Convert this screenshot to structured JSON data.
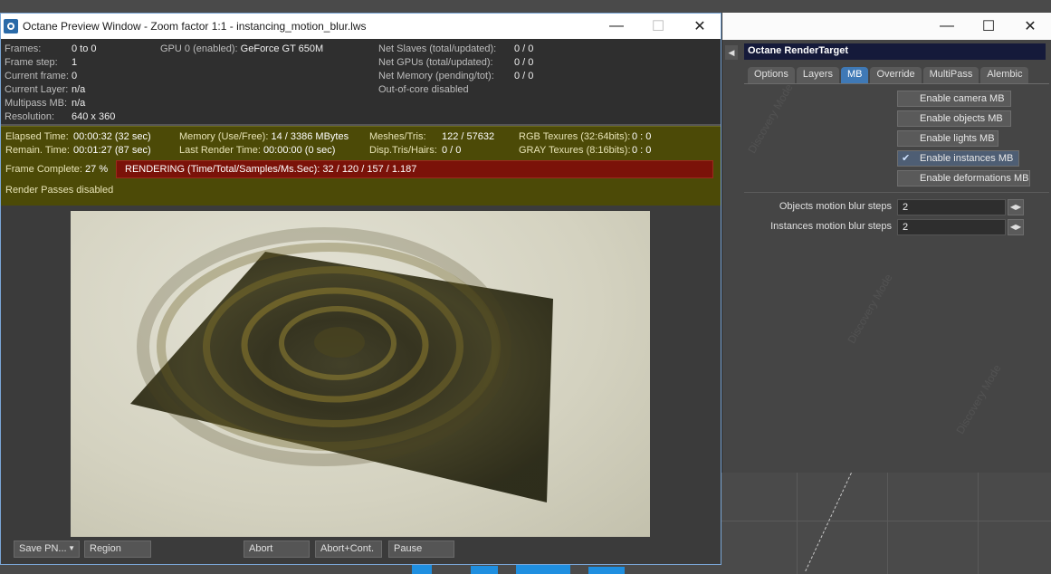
{
  "preview": {
    "title": "Octane Preview Window - Zoom factor 1:1 - instancing_motion_blur.lws",
    "info": {
      "frames_label": "Frames:",
      "frames": "0 to 0",
      "framestep_label": "Frame step:",
      "framestep": "1",
      "current_frame_label": "Current frame:",
      "current_frame": "0",
      "current_layer_label": "Current Layer:",
      "current_layer": "n/a",
      "multipass_label": "Multipass MB:",
      "multipass": "n/a",
      "resolution_label": "Resolution:",
      "resolution": "640 x 360",
      "gpu_label": "GPU  0 (enabled):",
      "gpu": "GeForce GT 650M",
      "net_slaves_label": "Net Slaves (total/updated):",
      "net_slaves": "0 / 0",
      "net_gpus_label": "Net GPUs (total/updated):",
      "net_gpus": "0 / 0",
      "net_memory_label": "Net Memory (pending/tot):",
      "net_memory": "0 / 0",
      "out_of_core": "Out-of-core disabled"
    },
    "status": {
      "elapsed_label": "Elapsed Time:",
      "elapsed": "00:00:32 (32 sec)",
      "remain_label": "Remain. Time:",
      "remain": "00:01:27 (87 sec)",
      "memory_label": "Memory (Use/Free):",
      "memory": "14 / 3386 MBytes",
      "last_render_label": "Last Render Time:",
      "last_render": "00:00:00 (0 sec)",
      "meshes_label": "Meshes/Tris:",
      "meshes": "122 / 57632",
      "disp_label": "Disp.Tris/Hairs:",
      "disp": "0 / 0",
      "rgb_label": "RGB Texures (32:64bits):",
      "rgb": "0 : 0",
      "gray_label": "GRAY Texures (8:16bits):",
      "gray": "0 : 0",
      "frame_complete_label": "Frame Complete:",
      "frame_complete": "27 %",
      "rendering": "RENDERING (Time/Total/Samples/Ms.Sec): 32 / 120 / 157 / 1.187",
      "render_passes": "Render Passes disabled"
    },
    "buttons": {
      "save": "Save PN...",
      "region": "Region",
      "abort": "Abort",
      "abort_cont": "Abort+Cont.",
      "pause": "Pause"
    }
  },
  "panel": {
    "title": "Octane RenderTarget",
    "tabs": [
      {
        "label": "Options",
        "active": false
      },
      {
        "label": "Layers",
        "active": false
      },
      {
        "label": "MB",
        "active": true
      },
      {
        "label": "Override",
        "active": false
      },
      {
        "label": "MultiPass",
        "active": false
      },
      {
        "label": "Alembic",
        "active": false
      }
    ],
    "toggles": [
      {
        "label": "Enable camera MB",
        "checked": false
      },
      {
        "label": "Enable objects MB",
        "checked": false
      },
      {
        "label": "Enable lights MB",
        "checked": false
      },
      {
        "label": "Enable instances MB",
        "checked": true
      },
      {
        "label": "Enable deformations MB",
        "checked": false
      }
    ],
    "objects_steps_label": "Objects motion blur steps",
    "objects_steps": "2",
    "instances_steps_label": "Instances motion blur steps",
    "instances_steps": "2"
  },
  "watermark": "Discovery Mode",
  "colors": {
    "status_bg": "#4c4a07",
    "render_bar": "#7b1209",
    "active_tab": "#3f79b6",
    "title_bar_bg": "#151a3a"
  }
}
